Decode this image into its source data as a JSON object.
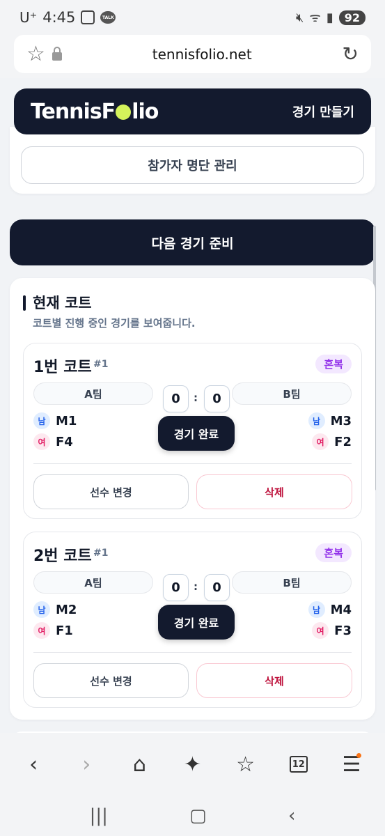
{
  "status_bar": {
    "carrier": "U⁺",
    "time": "4:45",
    "battery": "92"
  },
  "browser": {
    "url": "tennisfolio.net"
  },
  "header": {
    "logo_before": "TennisF",
    "logo_after": "lio",
    "create_label": "경기 만들기"
  },
  "roster_button": "참가자 명단 관리",
  "next_match_button": "다음 경기 준비",
  "current_courts": {
    "title": "현재 코트",
    "subtitle": "코트별 진행 중인 경기를 보여줍니다.",
    "courts": [
      {
        "name": "1번 코트",
        "number": "#1",
        "type": "혼복",
        "team_a": "A팀",
        "team_b": "B팀",
        "score_a": "0",
        "score_b": "0",
        "separator": ":",
        "finish_label": "경기 완료",
        "left_players": [
          {
            "gender": "남",
            "name": "M1"
          },
          {
            "gender": "여",
            "name": "F4"
          }
        ],
        "right_players": [
          {
            "gender": "남",
            "name": "M3"
          },
          {
            "gender": "여",
            "name": "F2"
          }
        ],
        "change_label": "선수 변경",
        "delete_label": "삭제"
      },
      {
        "name": "2번 코트",
        "number": "#1",
        "type": "혼복",
        "team_a": "A팀",
        "team_b": "B팀",
        "score_a": "0",
        "score_b": "0",
        "separator": ":",
        "finish_label": "경기 완료",
        "left_players": [
          {
            "gender": "남",
            "name": "M2"
          },
          {
            "gender": "여",
            "name": "F1"
          }
        ],
        "right_players": [
          {
            "gender": "남",
            "name": "M4"
          },
          {
            "gender": "여",
            "name": "F3"
          }
        ],
        "change_label": "선수 변경",
        "delete_label": "삭제"
      }
    ]
  },
  "toolbar": {
    "tabs_count": "12"
  },
  "colors": {
    "primary_dark": "#131a2e",
    "accent_ball": "#d4f25b",
    "type_badge": "#9333ea",
    "male": "#2563eb",
    "female": "#e11d63",
    "delete": "#be123c"
  }
}
